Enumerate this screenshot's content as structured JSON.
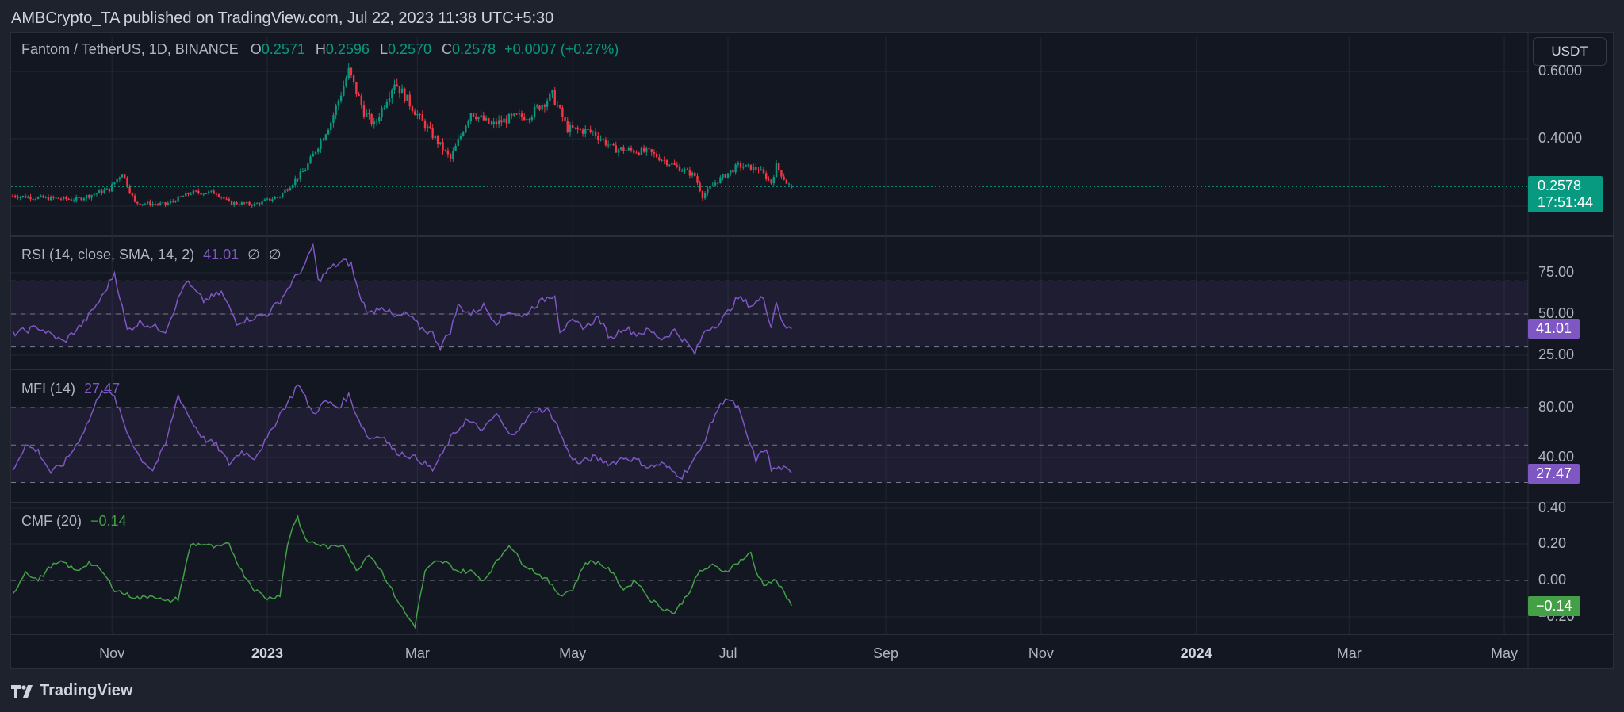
{
  "header": {
    "publisher_line": "AMBCrypto_TA published on TradingView.com, Jul 22, 2023 11:38 UTC+5:30"
  },
  "symbol": {
    "title": "Fantom / TetherUS, 1D, BINANCE",
    "o_label": "O",
    "o": "0.2571",
    "h_label": "H",
    "h": "0.2596",
    "l_label": "L",
    "l": "0.2570",
    "c_label": "C",
    "c": "0.2578",
    "change": "+0.0007 (+0.27%)"
  },
  "currency_button": "USDT",
  "price_axis": {
    "ticks": [
      "0.6000",
      "0.4000"
    ],
    "last_price": "0.2578",
    "countdown": "17:51:44"
  },
  "rsi": {
    "title": "RSI (14, close, SMA, 14, 2)",
    "value": "41.01",
    "extra1": "∅",
    "extra2": "∅",
    "ticks": [
      "75.00",
      "50.00",
      "25.00"
    ]
  },
  "mfi": {
    "title": "MFI (14)",
    "value": "27.47",
    "ticks": [
      "80.00",
      "40.00"
    ]
  },
  "cmf": {
    "title": "CMF (20)",
    "value": "−0.14",
    "ticks": [
      "0.40",
      "0.20",
      "0.00",
      "−0.20"
    ]
  },
  "time_axis": [
    {
      "label": "Nov",
      "day": -61,
      "bold": false
    },
    {
      "label": "2023",
      "day": 0,
      "bold": true
    },
    {
      "label": "Mar",
      "day": 59,
      "bold": false
    },
    {
      "label": "May",
      "day": 120,
      "bold": false
    },
    {
      "label": "Jul",
      "day": 181,
      "bold": false
    },
    {
      "label": "Sep",
      "day": 243,
      "bold": false
    },
    {
      "label": "Nov",
      "day": 304,
      "bold": false
    },
    {
      "label": "2024",
      "day": 365,
      "bold": true
    },
    {
      "label": "Mar",
      "day": 425,
      "bold": false
    },
    {
      "label": "May",
      "day": 486,
      "bold": false
    }
  ],
  "footer": {
    "brand": "TradingView"
  },
  "colors": {
    "up": "#089981",
    "down": "#f23645",
    "rsi": "#7e57c2",
    "mfi": "#7e57c2",
    "cmf": "#43a047",
    "band": "#7e57c2"
  },
  "chart_data": [
    {
      "type": "candlestick",
      "title": "Fantom / TetherUS, 1D, BINANCE",
      "x_unit": "days from 2023-01-01",
      "ylim": [
        0.15,
        0.68
      ],
      "close_anchors": [
        [
          -100,
          0.231
        ],
        [
          -90,
          0.225
        ],
        [
          -75,
          0.22
        ],
        [
          -62,
          0.25
        ],
        [
          -57,
          0.3
        ],
        [
          -52,
          0.21
        ],
        [
          -40,
          0.205
        ],
        [
          -30,
          0.24
        ],
        [
          -20,
          0.24
        ],
        [
          -15,
          0.21
        ],
        [
          -5,
          0.205
        ],
        [
          5,
          0.23
        ],
        [
          15,
          0.31
        ],
        [
          25,
          0.45
        ],
        [
          32,
          0.6
        ],
        [
          38,
          0.48
        ],
        [
          42,
          0.44
        ],
        [
          50,
          0.57
        ],
        [
          60,
          0.46
        ],
        [
          68,
          0.38
        ],
        [
          72,
          0.34
        ],
        [
          80,
          0.48
        ],
        [
          88,
          0.44
        ],
        [
          95,
          0.46
        ],
        [
          103,
          0.47
        ],
        [
          112,
          0.53
        ],
        [
          118,
          0.43
        ],
        [
          128,
          0.42
        ],
        [
          136,
          0.37
        ],
        [
          150,
          0.36
        ],
        [
          160,
          0.32
        ],
        [
          168,
          0.29
        ],
        [
          171,
          0.23
        ],
        [
          176,
          0.27
        ],
        [
          185,
          0.32
        ],
        [
          193,
          0.31
        ],
        [
          198,
          0.27
        ],
        [
          200,
          0.32
        ],
        [
          204,
          0.27
        ],
        [
          206,
          0.2578
        ]
      ]
    },
    {
      "type": "line",
      "title": "RSI (14, close, SMA, 14, 2)",
      "ylim": [
        20,
        95
      ],
      "bands": [
        30,
        70
      ],
      "midline": 50,
      "points": [
        [
          -100,
          38
        ],
        [
          -90,
          42
        ],
        [
          -80,
          33
        ],
        [
          -72,
          45
        ],
        [
          -65,
          60
        ],
        [
          -60,
          75
        ],
        [
          -55,
          40
        ],
        [
          -50,
          45
        ],
        [
          -40,
          40
        ],
        [
          -32,
          70
        ],
        [
          -25,
          58
        ],
        [
          -18,
          63
        ],
        [
          -12,
          45
        ],
        [
          -5,
          48
        ],
        [
          0,
          50
        ],
        [
          5,
          58
        ],
        [
          10,
          70
        ],
        [
          15,
          80
        ],
        [
          18,
          92
        ],
        [
          20,
          70
        ],
        [
          25,
          78
        ],
        [
          30,
          82
        ],
        [
          33,
          80
        ],
        [
          36,
          62
        ],
        [
          40,
          50
        ],
        [
          45,
          55
        ],
        [
          50,
          48
        ],
        [
          55,
          50
        ],
        [
          60,
          42
        ],
        [
          65,
          38
        ],
        [
          68,
          30
        ],
        [
          72,
          40
        ],
        [
          75,
          55
        ],
        [
          80,
          50
        ],
        [
          85,
          55
        ],
        [
          90,
          45
        ],
        [
          95,
          52
        ],
        [
          100,
          48
        ],
        [
          105,
          55
        ],
        [
          110,
          60
        ],
        [
          113,
          62
        ],
        [
          115,
          40
        ],
        [
          120,
          45
        ],
        [
          125,
          42
        ],
        [
          130,
          48
        ],
        [
          135,
          35
        ],
        [
          140,
          42
        ],
        [
          145,
          38
        ],
        [
          150,
          40
        ],
        [
          155,
          35
        ],
        [
          160,
          40
        ],
        [
          165,
          32
        ],
        [
          168,
          26
        ],
        [
          172,
          40
        ],
        [
          178,
          45
        ],
        [
          185,
          60
        ],
        [
          190,
          55
        ],
        [
          195,
          60
        ],
        [
          198,
          42
        ],
        [
          200,
          58
        ],
        [
          203,
          42
        ],
        [
          206,
          41.01
        ]
      ]
    },
    {
      "type": "line",
      "title": "MFI (14)",
      "ylim": [
        0,
        100
      ],
      "bands": [
        20,
        80
      ],
      "midline": 50,
      "points": [
        [
          -100,
          30
        ],
        [
          -95,
          50
        ],
        [
          -90,
          45
        ],
        [
          -85,
          28
        ],
        [
          -80,
          35
        ],
        [
          -75,
          50
        ],
        [
          -70,
          70
        ],
        [
          -65,
          95
        ],
        [
          -60,
          88
        ],
        [
          -55,
          60
        ],
        [
          -50,
          40
        ],
        [
          -45,
          30
        ],
        [
          -40,
          50
        ],
        [
          -35,
          90
        ],
        [
          -30,
          70
        ],
        [
          -25,
          55
        ],
        [
          -20,
          50
        ],
        [
          -15,
          35
        ],
        [
          -10,
          45
        ],
        [
          -5,
          40
        ],
        [
          0,
          55
        ],
        [
          5,
          75
        ],
        [
          10,
          90
        ],
        [
          12,
          100
        ],
        [
          18,
          75
        ],
        [
          23,
          85
        ],
        [
          28,
          80
        ],
        [
          32,
          90
        ],
        [
          36,
          70
        ],
        [
          40,
          55
        ],
        [
          45,
          58
        ],
        [
          50,
          45
        ],
        [
          55,
          42
        ],
        [
          60,
          38
        ],
        [
          65,
          30
        ],
        [
          68,
          40
        ],
        [
          72,
          55
        ],
        [
          78,
          70
        ],
        [
          85,
          62
        ],
        [
          90,
          75
        ],
        [
          95,
          58
        ],
        [
          100,
          65
        ],
        [
          105,
          78
        ],
        [
          110,
          78
        ],
        [
          113,
          70
        ],
        [
          118,
          45
        ],
        [
          122,
          35
        ],
        [
          128,
          40
        ],
        [
          135,
          35
        ],
        [
          140,
          40
        ],
        [
          145,
          38
        ],
        [
          150,
          32
        ],
        [
          155,
          35
        ],
        [
          160,
          28
        ],
        [
          163,
          25
        ],
        [
          170,
          45
        ],
        [
          176,
          75
        ],
        [
          180,
          88
        ],
        [
          185,
          80
        ],
        [
          188,
          60
        ],
        [
          192,
          38
        ],
        [
          196,
          48
        ],
        [
          198,
          30
        ],
        [
          202,
          32
        ],
        [
          206,
          27.47
        ]
      ]
    },
    {
      "type": "line",
      "title": "CMF (20)",
      "ylim": [
        -0.3,
        0.45
      ],
      "zero_line": 0,
      "points": [
        [
          -100,
          -0.08
        ],
        [
          -95,
          0.05
        ],
        [
          -90,
          0.0
        ],
        [
          -85,
          0.08
        ],
        [
          -80,
          0.1
        ],
        [
          -75,
          0.05
        ],
        [
          -70,
          0.1
        ],
        [
          -65,
          0.05
        ],
        [
          -60,
          -0.05
        ],
        [
          -55,
          -0.08
        ],
        [
          -50,
          -0.1
        ],
        [
          -45,
          -0.08
        ],
        [
          -40,
          -0.12
        ],
        [
          -35,
          -0.1
        ],
        [
          -30,
          0.2
        ],
        [
          -25,
          0.2
        ],
        [
          -20,
          0.18
        ],
        [
          -15,
          0.2
        ],
        [
          -10,
          0.05
        ],
        [
          -5,
          -0.05
        ],
        [
          0,
          -0.1
        ],
        [
          5,
          -0.08
        ],
        [
          8,
          0.2
        ],
        [
          10,
          0.3
        ],
        [
          12,
          0.35
        ],
        [
          15,
          0.22
        ],
        [
          20,
          0.2
        ],
        [
          25,
          0.18
        ],
        [
          30,
          0.2
        ],
        [
          35,
          0.05
        ],
        [
          40,
          0.15
        ],
        [
          45,
          0.05
        ],
        [
          50,
          -0.08
        ],
        [
          55,
          -0.2
        ],
        [
          58,
          -0.25
        ],
        [
          62,
          0.05
        ],
        [
          66,
          0.1
        ],
        [
          70,
          0.1
        ],
        [
          75,
          0.05
        ],
        [
          80,
          0.05
        ],
        [
          85,
          0.0
        ],
        [
          90,
          0.1
        ],
        [
          95,
          0.2
        ],
        [
          100,
          0.1
        ],
        [
          105,
          0.05
        ],
        [
          110,
          0.0
        ],
        [
          115,
          -0.08
        ],
        [
          120,
          -0.05
        ],
        [
          125,
          0.1
        ],
        [
          130,
          0.1
        ],
        [
          135,
          0.05
        ],
        [
          140,
          -0.05
        ],
        [
          145,
          0.0
        ],
        [
          150,
          -0.1
        ],
        [
          155,
          -0.15
        ],
        [
          160,
          -0.18
        ],
        [
          165,
          -0.08
        ],
        [
          170,
          0.05
        ],
        [
          175,
          0.08
        ],
        [
          180,
          0.05
        ],
        [
          185,
          0.1
        ],
        [
          190,
          0.15
        ],
        [
          192,
          0.05
        ],
        [
          195,
          -0.02
        ],
        [
          200,
          0.0
        ],
        [
          206,
          -0.14
        ]
      ]
    }
  ]
}
